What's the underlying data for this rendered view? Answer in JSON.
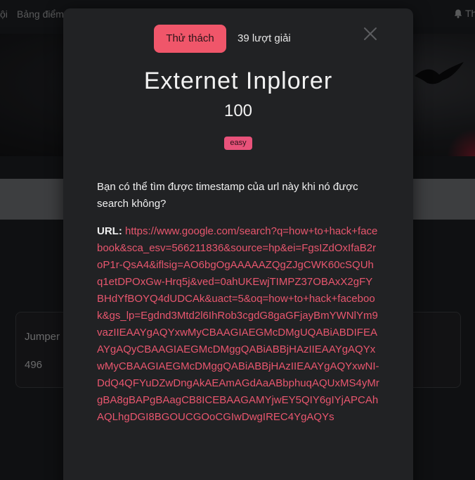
{
  "nav": {
    "left_fragment": "ội",
    "scoreboard": "Bảng điểm",
    "right_fragment": "Th"
  },
  "background_card": {
    "title": "Jumper",
    "points": "496"
  },
  "modal": {
    "tab_challenge": "Thử thách",
    "tab_solves": "39 lượt giải",
    "title": "Externet Inplorer",
    "points": "100",
    "difficulty": "easy",
    "description": "Bạn có thể tìm được timestamp của url này khi nó được search không?",
    "url_label": "URL:",
    "url": "https://www.google.com/search?q=how+to+hack+facebook&sca_esv=566211836&source=hp&ei=FgsIZdOxIfaB2roP1r-QsA4&iflsig=AO6bgOgAAAAAZQgZJgCWK60cSQUhq1etDPOxGw-Hrq5j&ved=0ahUKEwjTIMPZ37OBAxX2gFYBHdYfBOYQ4dUDCAk&uact=5&oq=how+to+hack+facebook&gs_lp=Egdnd3Mtd2l6IhRob3cgdG8gaGFjayBmYWNlYm9vazIIEAAYgAQYxwMyCBAAGIAEGMcDMgUQABiABDIFEAAYgAQyCBAAGIAEGMcDMggQABiABBjHAzIIEAAYgAQYxwMyCBAAGIAEGMcDMggQABiABBjHAzIIEAAYgAQYxwNI-DdQ4QFYuDZwDngAkAEAmAGdAaABbphuqAQUxMS4yMrgBA8gBAPgBAagCB8ICEBAAGAMYjwEY5QIY6gIYjAPCAhAQLhgDGI8BGOUCGOoCGIwDwgIREC4YgAQYs"
  },
  "colors": {
    "accent": "#f0566a",
    "badge": "#e8527a",
    "link": "#e8566e",
    "modal_bg": "#212224"
  },
  "icons": {
    "close": "close-icon",
    "bell": "bell-icon"
  }
}
